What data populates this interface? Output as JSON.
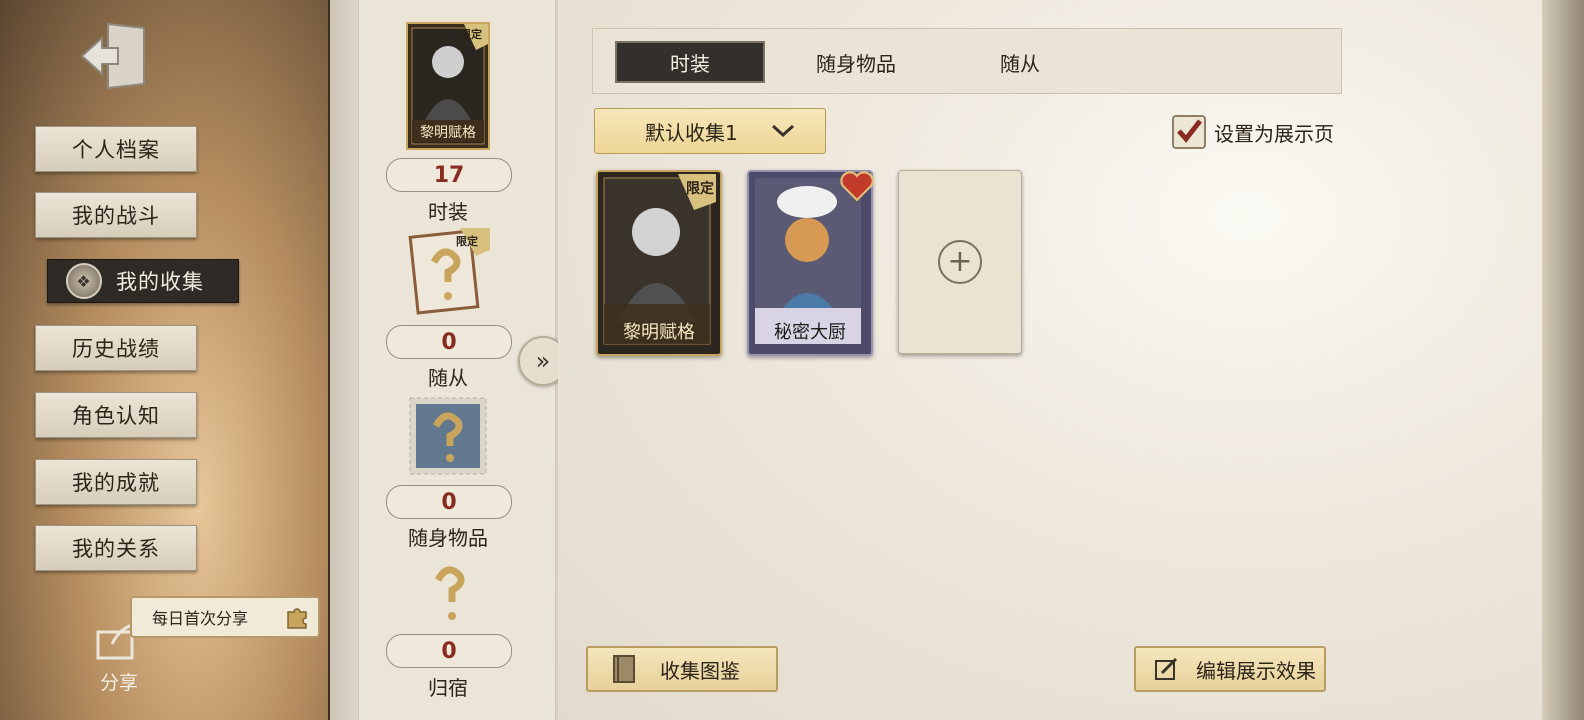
{
  "sidebar": {
    "items": [
      {
        "label": "个人档案",
        "active": false
      },
      {
        "label": "我的战斗",
        "active": false
      },
      {
        "label": "我的收集",
        "active": true
      },
      {
        "label": "历史战绩",
        "active": false
      },
      {
        "label": "角色认知",
        "active": false
      },
      {
        "label": "我的成就",
        "active": false
      },
      {
        "label": "我的关系",
        "active": false
      }
    ],
    "share_tip": "每日首次分享",
    "share_label": "分享"
  },
  "middle": {
    "top_card": {
      "name": "黎明赋格",
      "badge": "限定"
    },
    "categories": [
      {
        "count": "17",
        "label": "时装"
      },
      {
        "count": "0",
        "label": "随从",
        "badge": "限定"
      },
      {
        "count": "0",
        "label": "随身物品"
      },
      {
        "count": "0",
        "label": "归宿"
      }
    ]
  },
  "main": {
    "tabs": [
      {
        "label": "时装",
        "active": true
      },
      {
        "label": "随身物品",
        "active": false
      },
      {
        "label": "随从",
        "active": false
      }
    ],
    "dropdown_label": "默认收集1",
    "checkbox_label": "设置为展示页",
    "checkbox_checked": true,
    "cards": [
      {
        "name": "黎明赋格",
        "badge": "限定"
      },
      {
        "name": "秘密大厨"
      }
    ],
    "buttons": {
      "collection": "收集图鉴",
      "edit": "编辑展示效果"
    }
  },
  "colors": {
    "accent_red": "#8a2b22",
    "gold": "#c9a45c",
    "dark_tab": "#33302c"
  }
}
